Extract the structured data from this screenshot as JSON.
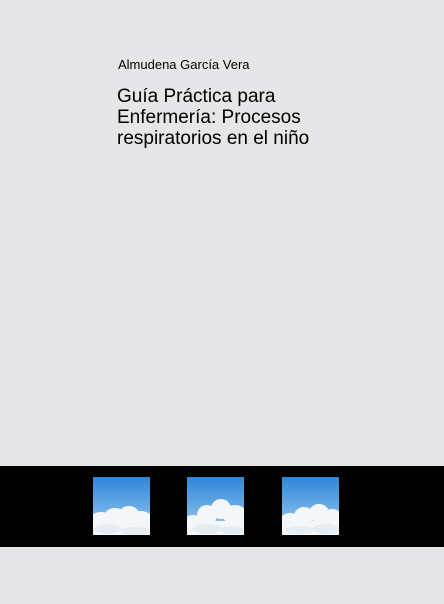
{
  "cover": {
    "author": "Almudena García Vera",
    "title_lines": [
      "Guía Práctica para",
      "Enfermería: Procesos",
      "respiratorios en el niño"
    ]
  },
  "band": {
    "images": [
      {
        "icon": "sky-clouds-image"
      },
      {
        "icon": "sky-clouds-image"
      },
      {
        "icon": "sky-clouds-image"
      }
    ]
  },
  "colors": {
    "background": "#e6e6e8",
    "band": "#000000",
    "sky_top": "#2f86d6",
    "sky_bottom": "#9fd0f4",
    "cloud": "#f4f7fa"
  }
}
